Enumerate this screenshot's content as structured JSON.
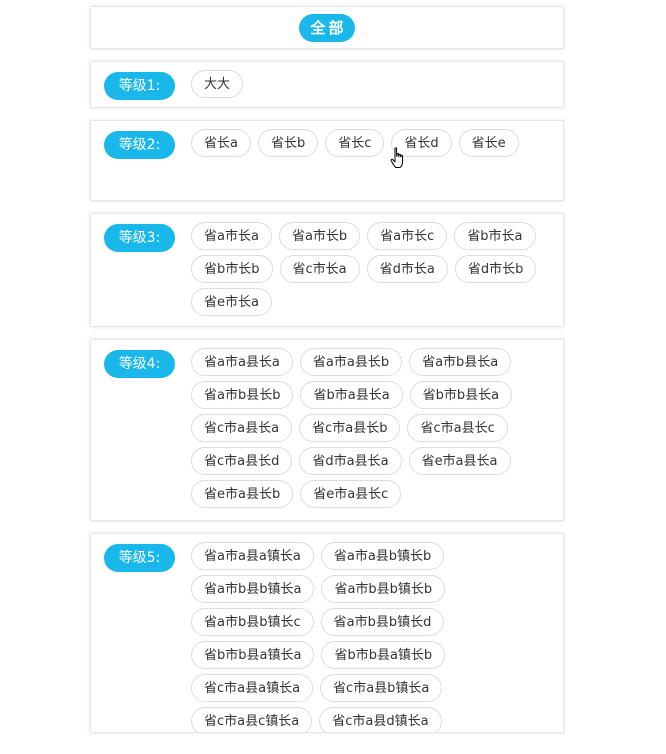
{
  "all_button": "全部",
  "levels": [
    {
      "label": "等级1:",
      "items": [
        "大大"
      ]
    },
    {
      "label": "等级2:",
      "items": [
        "省长a",
        "省长b",
        "省长c",
        "省长d",
        "省长e"
      ]
    },
    {
      "label": "等级3:",
      "items": [
        "省a市长a",
        "省a市长b",
        "省a市长c",
        "省b市长a",
        "省b市长b",
        "省c市长a",
        "省d市长a",
        "省d市长b",
        "省e市长a"
      ]
    },
    {
      "label": "等级4:",
      "items": [
        "省a市a县长a",
        "省a市a县长b",
        "省a市b县长a",
        "省a市b县长b",
        "省b市a县长a",
        "省b市b县长a",
        "省c市a县长a",
        "省c市a县长b",
        "省c市a县长c",
        "省c市a县长d",
        "省d市a县长a",
        "省e市a县长a",
        "省e市a县长b",
        "省e市a县长c"
      ]
    },
    {
      "label": "等级5:",
      "items": [
        "省a市a县a镇长a",
        "省a市a县b镇长b",
        "省a市b县b镇长a",
        "省a市b县b镇长b",
        "省a市b县b镇长c",
        "省a市b县b镇长d",
        "省b市b县a镇长a",
        "省b市b县a镇长b",
        "省c市a县a镇长a",
        "省c市a县b镇长a",
        "省c市a县c镇长a",
        "省c市a县d镇长a"
      ]
    }
  ],
  "accent_color": "#1ab8ea",
  "cursor_icon": "hand-pointer-icon"
}
